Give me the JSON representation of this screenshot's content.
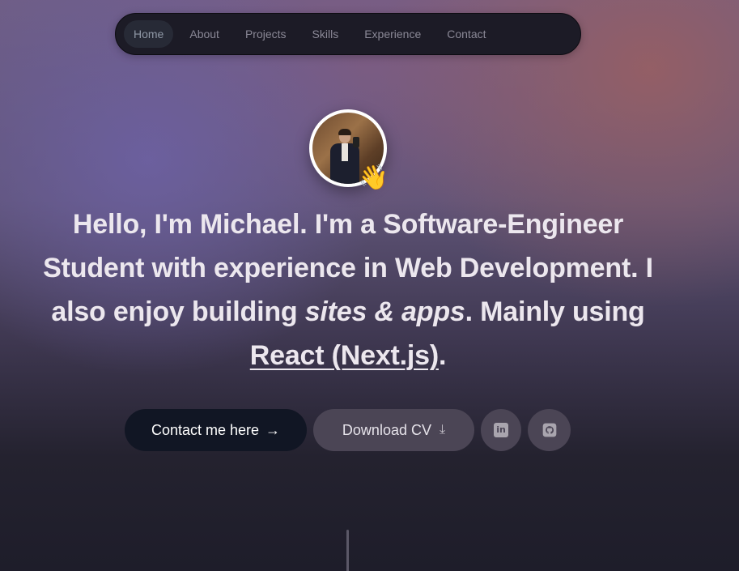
{
  "nav": {
    "items": [
      {
        "label": "Home",
        "active": true
      },
      {
        "label": "About"
      },
      {
        "label": "Projects"
      },
      {
        "label": "Skills"
      },
      {
        "label": "Experience"
      },
      {
        "label": "Contact"
      }
    ]
  },
  "hero": {
    "wave_emoji": "👋",
    "headline": {
      "p1_bold": "Hello, I'm Michael.",
      "p2": " I'm a ",
      "p3_bold": "Software-Engineer Student",
      "p4": " with experience in ",
      "p5_bold": "Web Development",
      "p6": ". I also enjoy building ",
      "p7_italic": "sites & apps",
      "p8": ". Mainly using ",
      "p9_link": "React (Next.js)",
      "p10": "."
    }
  },
  "actions": {
    "contact_label": "Contact me here",
    "contact_arrow": "→",
    "cv_label": "Download CV",
    "cv_icon": "⤓",
    "linkedin_icon": "linkedin-icon",
    "github_icon": "github-icon",
    "linkedin_glyph": "in"
  },
  "colors": {
    "nav_bg": "#1c1b26",
    "contact_bg": "#111624",
    "secondary_bg": "#4b4555",
    "text": "#ece7ee"
  }
}
